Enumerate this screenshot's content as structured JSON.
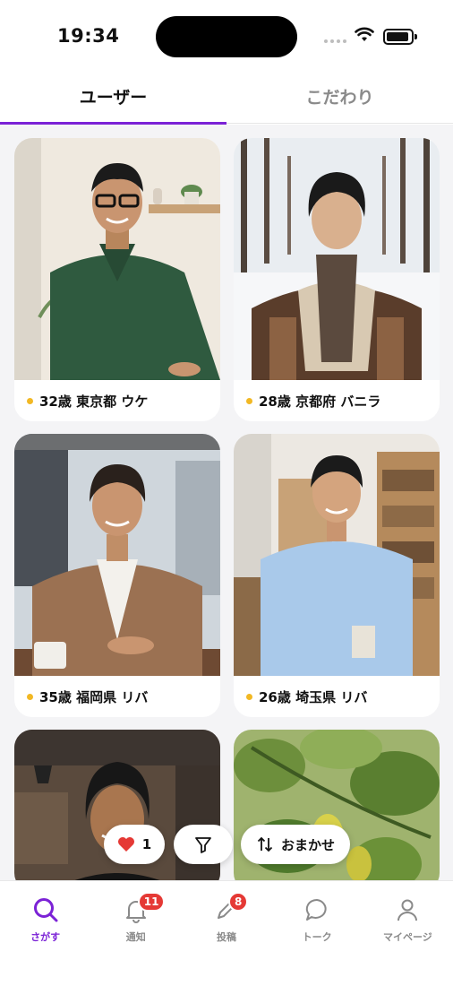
{
  "status_bar": {
    "time": "19:34"
  },
  "tabs": [
    {
      "label": "ユーザー",
      "active": true
    },
    {
      "label": "こだわり",
      "active": false
    }
  ],
  "cards": [
    {
      "age": "32歳",
      "prefecture": "東京都",
      "role": "ウケ",
      "online": true
    },
    {
      "age": "28歳",
      "prefecture": "京都府",
      "role": "バニラ",
      "online": true
    },
    {
      "age": "35歳",
      "prefecture": "福岡県",
      "role": "リバ",
      "online": true
    },
    {
      "age": "26歳",
      "prefecture": "埼玉県",
      "role": "リバ",
      "online": true
    }
  ],
  "floating": {
    "like_count": "1",
    "filter_icon": "filter-icon",
    "sort_label": "おまかせ"
  },
  "bottom_nav": [
    {
      "label": "さがす",
      "icon": "search-icon",
      "active": true,
      "badge": ""
    },
    {
      "label": "通知",
      "icon": "bell-icon",
      "active": false,
      "badge": "11"
    },
    {
      "label": "投稿",
      "icon": "pen-icon",
      "active": false,
      "badge": "8"
    },
    {
      "label": "トーク",
      "icon": "chat-bubble-icon",
      "active": false,
      "badge": ""
    },
    {
      "label": "マイページ",
      "icon": "person-icon",
      "active": false,
      "badge": ""
    }
  ],
  "colors": {
    "accent": "#7b22d6",
    "badge": "#e53935",
    "heart": "#e53935",
    "online": "#f2b824"
  }
}
